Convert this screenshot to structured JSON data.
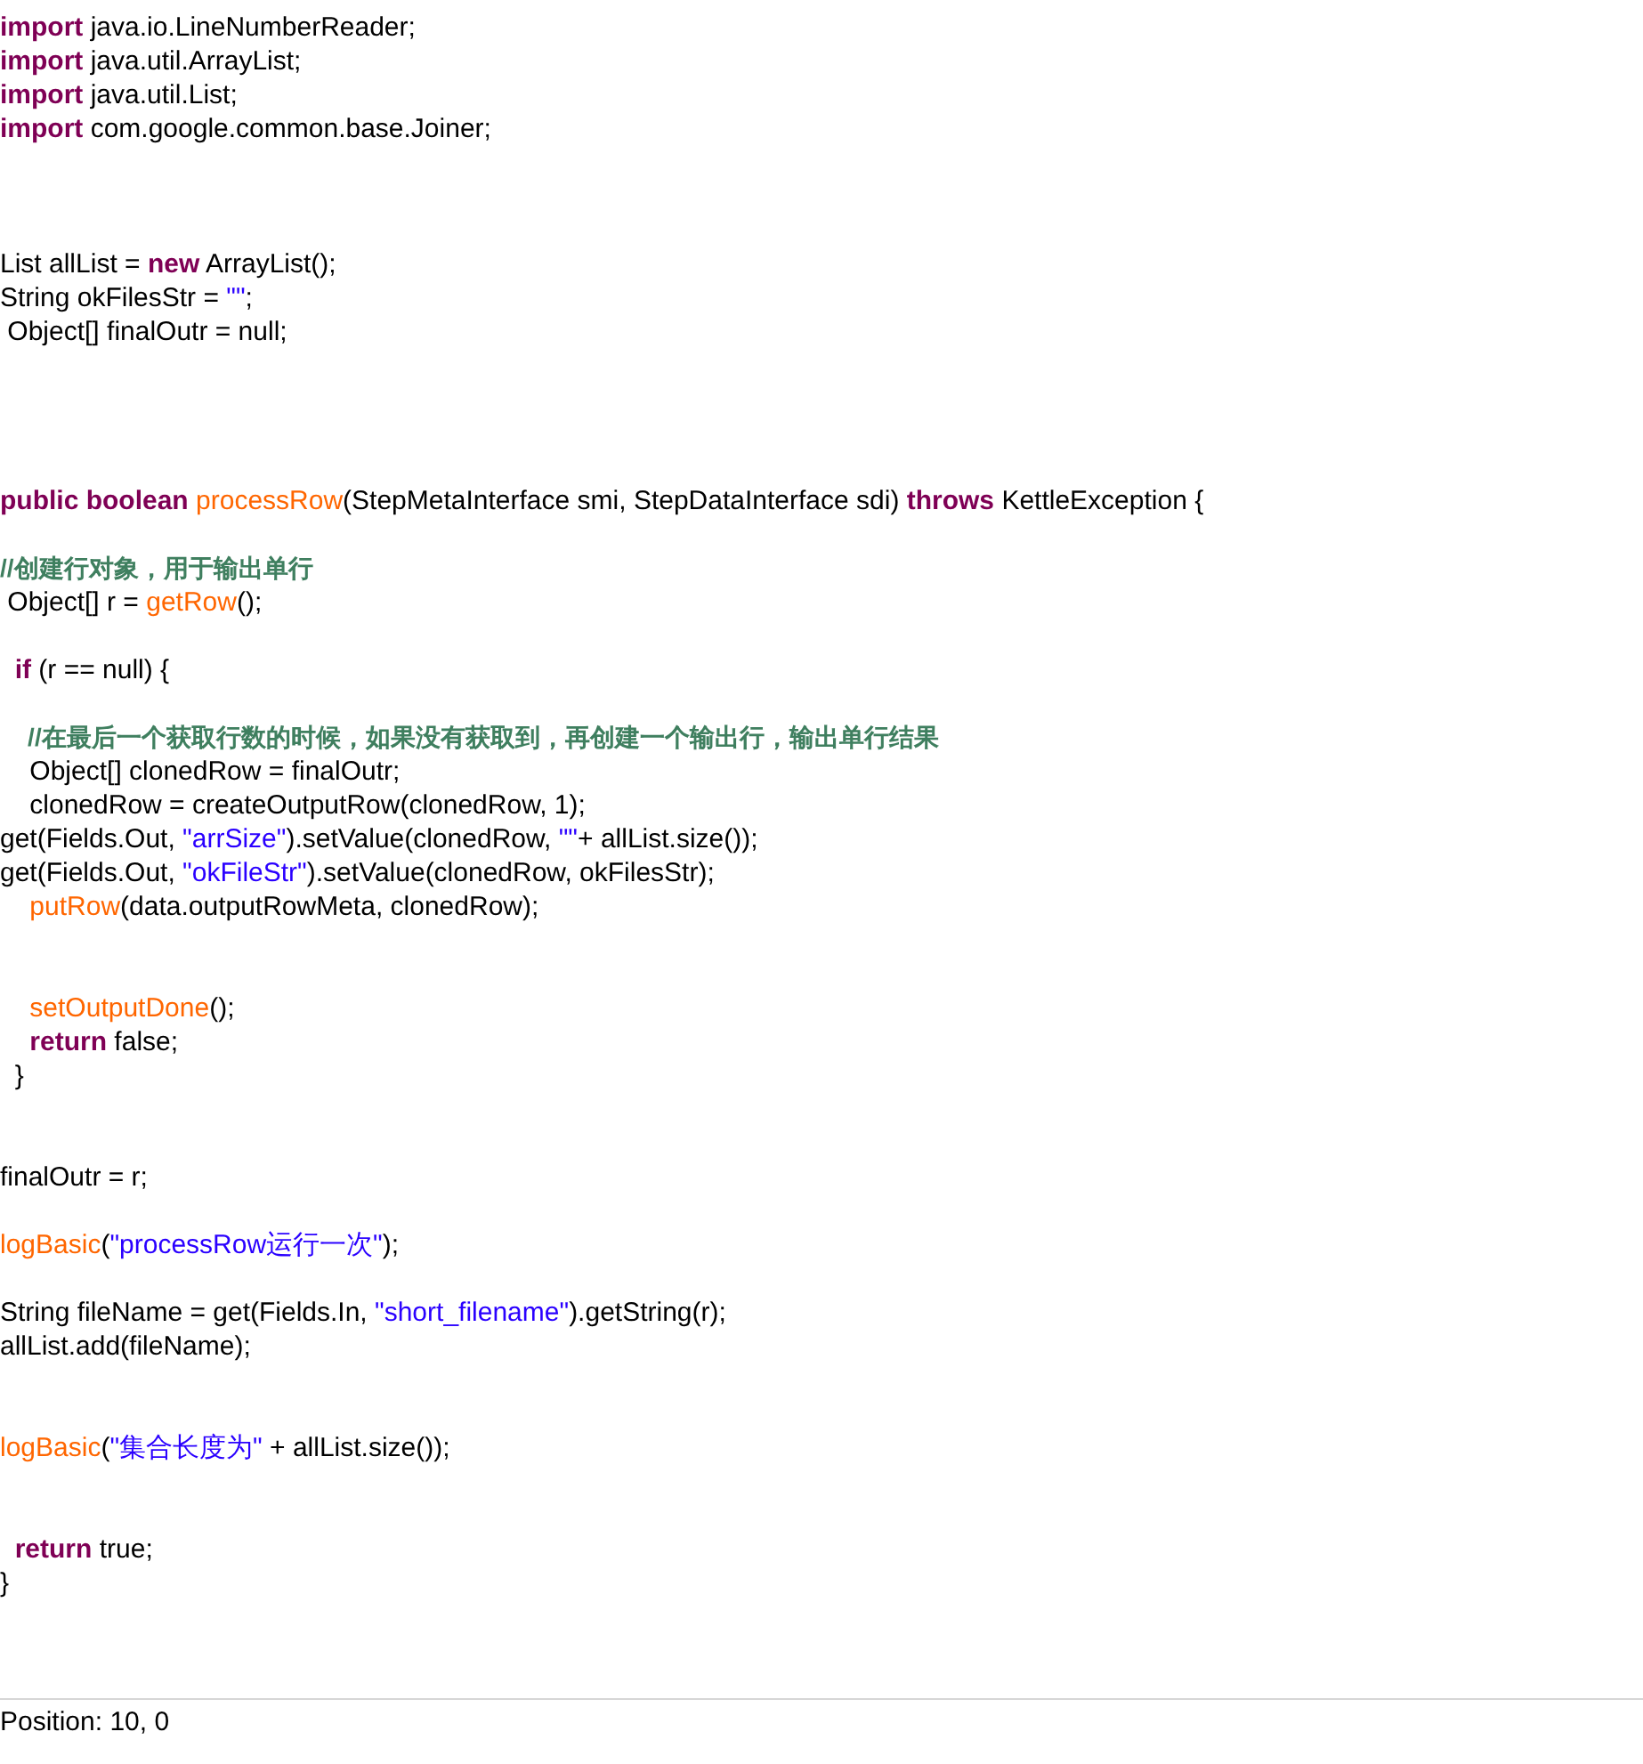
{
  "editor": {
    "lines": [
      {
        "kind": "code",
        "segments": [
          {
            "kind": "keyword",
            "text": "import"
          },
          {
            "kind": "plain",
            "text": " java.io.LineNumberReader;"
          }
        ]
      },
      {
        "kind": "code",
        "segments": [
          {
            "kind": "keyword",
            "text": "import"
          },
          {
            "kind": "plain",
            "text": " java.util.ArrayList;"
          }
        ]
      },
      {
        "kind": "code",
        "segments": [
          {
            "kind": "keyword",
            "text": "import"
          },
          {
            "kind": "plain",
            "text": " java.util.List;"
          }
        ]
      },
      {
        "kind": "code",
        "segments": [
          {
            "kind": "keyword",
            "text": "import"
          },
          {
            "kind": "plain",
            "text": " com.google.common.base.Joiner;"
          }
        ]
      },
      {
        "kind": "blank"
      },
      {
        "kind": "blank"
      },
      {
        "kind": "blank"
      },
      {
        "kind": "code",
        "segments": [
          {
            "kind": "plain",
            "text": "List allList = "
          },
          {
            "kind": "keyword",
            "text": "new"
          },
          {
            "kind": "plain",
            "text": " ArrayList();"
          }
        ]
      },
      {
        "kind": "code",
        "segments": [
          {
            "kind": "plain",
            "text": "String okFilesStr = "
          },
          {
            "kind": "string",
            "text": "\"\""
          },
          {
            "kind": "plain",
            "text": ";"
          }
        ]
      },
      {
        "kind": "code",
        "segments": [
          {
            "kind": "plain",
            "text": " Object[] finalOutr = null;"
          }
        ]
      },
      {
        "kind": "blank"
      },
      {
        "kind": "blank"
      },
      {
        "kind": "blank"
      },
      {
        "kind": "blank"
      },
      {
        "kind": "code",
        "segments": [
          {
            "kind": "keyword",
            "text": "public boolean "
          },
          {
            "kind": "method",
            "text": "processRow"
          },
          {
            "kind": "plain",
            "text": "(StepMetaInterface smi, StepDataInterface sdi) "
          },
          {
            "kind": "keyword",
            "text": "throws"
          },
          {
            "kind": "plain",
            "text": " KettleException {"
          }
        ]
      },
      {
        "kind": "blank"
      },
      {
        "kind": "code",
        "segments": [
          {
            "kind": "comment",
            "text": "//创建行对象，用于输出单行"
          }
        ]
      },
      {
        "kind": "code",
        "segments": [
          {
            "kind": "plain",
            "text": " Object[] r = "
          },
          {
            "kind": "method",
            "text": "getRow"
          },
          {
            "kind": "plain",
            "text": "();"
          }
        ]
      },
      {
        "kind": "blank"
      },
      {
        "kind": "code",
        "segments": [
          {
            "kind": "keyword",
            "text": "  if"
          },
          {
            "kind": "plain",
            "text": " (r == null) {"
          }
        ]
      },
      {
        "kind": "blank"
      },
      {
        "kind": "code",
        "segments": [
          {
            "kind": "comment",
            "text": "    //在最后一个获取行数的时候，如果没有获取到，再创建一个输出行，输出单行结果"
          }
        ]
      },
      {
        "kind": "code",
        "segments": [
          {
            "kind": "plain",
            "text": "    Object[] clonedRow = finalOutr;"
          }
        ]
      },
      {
        "kind": "code",
        "segments": [
          {
            "kind": "plain",
            "text": "    clonedRow = createOutputRow(clonedRow, 1);"
          }
        ]
      },
      {
        "kind": "code",
        "segments": [
          {
            "kind": "plain",
            "text": "get(Fields.Out, "
          },
          {
            "kind": "string",
            "text": "\"arrSize\""
          },
          {
            "kind": "plain",
            "text": ").setValue(clonedRow, "
          },
          {
            "kind": "string",
            "text": "\"\""
          },
          {
            "kind": "plain",
            "text": "+ allList.size());"
          }
        ]
      },
      {
        "kind": "code",
        "segments": [
          {
            "kind": "plain",
            "text": "get(Fields.Out, "
          },
          {
            "kind": "string",
            "text": "\"okFileStr\""
          },
          {
            "kind": "plain",
            "text": ").setValue(clonedRow, okFilesStr);"
          }
        ]
      },
      {
        "kind": "code",
        "segments": [
          {
            "kind": "method",
            "text": "    putRow"
          },
          {
            "kind": "plain",
            "text": "(data.outputRowMeta, clonedRow);"
          }
        ]
      },
      {
        "kind": "blank"
      },
      {
        "kind": "blank"
      },
      {
        "kind": "code",
        "segments": [
          {
            "kind": "method",
            "text": "    setOutputDone"
          },
          {
            "kind": "plain",
            "text": "();"
          }
        ]
      },
      {
        "kind": "code",
        "segments": [
          {
            "kind": "keyword",
            "text": "    return"
          },
          {
            "kind": "plain",
            "text": " false;"
          }
        ]
      },
      {
        "kind": "code",
        "segments": [
          {
            "kind": "plain",
            "text": "  }"
          }
        ]
      },
      {
        "kind": "blank"
      },
      {
        "kind": "blank"
      },
      {
        "kind": "code",
        "segments": [
          {
            "kind": "plain",
            "text": "finalOutr = r;"
          }
        ]
      },
      {
        "kind": "blank"
      },
      {
        "kind": "code",
        "segments": [
          {
            "kind": "method",
            "text": "logBasic"
          },
          {
            "kind": "plain",
            "text": "("
          },
          {
            "kind": "string",
            "text": "\"processRow运行一次\""
          },
          {
            "kind": "plain",
            "text": ");"
          }
        ]
      },
      {
        "kind": "blank"
      },
      {
        "kind": "code",
        "segments": [
          {
            "kind": "plain",
            "text": "String fileName = get(Fields.In, "
          },
          {
            "kind": "string",
            "text": "\"short_filename\""
          },
          {
            "kind": "plain",
            "text": ").getString(r);"
          }
        ]
      },
      {
        "kind": "code",
        "segments": [
          {
            "kind": "plain",
            "text": "allList.add(fileName);"
          }
        ]
      },
      {
        "kind": "blank"
      },
      {
        "kind": "blank"
      },
      {
        "kind": "code",
        "segments": [
          {
            "kind": "method",
            "text": "logBasic"
          },
          {
            "kind": "plain",
            "text": "("
          },
          {
            "kind": "string",
            "text": "\"集合长度为\""
          },
          {
            "kind": "plain",
            "text": " + allList.size());"
          }
        ]
      },
      {
        "kind": "blank"
      },
      {
        "kind": "blank"
      },
      {
        "kind": "code",
        "segments": [
          {
            "kind": "keyword",
            "text": "  return"
          },
          {
            "kind": "plain",
            "text": " true;"
          }
        ]
      },
      {
        "kind": "code",
        "segments": [
          {
            "kind": "plain",
            "text": "}"
          }
        ]
      }
    ]
  },
  "status_bar": {
    "position": "Position: 10, 0"
  }
}
